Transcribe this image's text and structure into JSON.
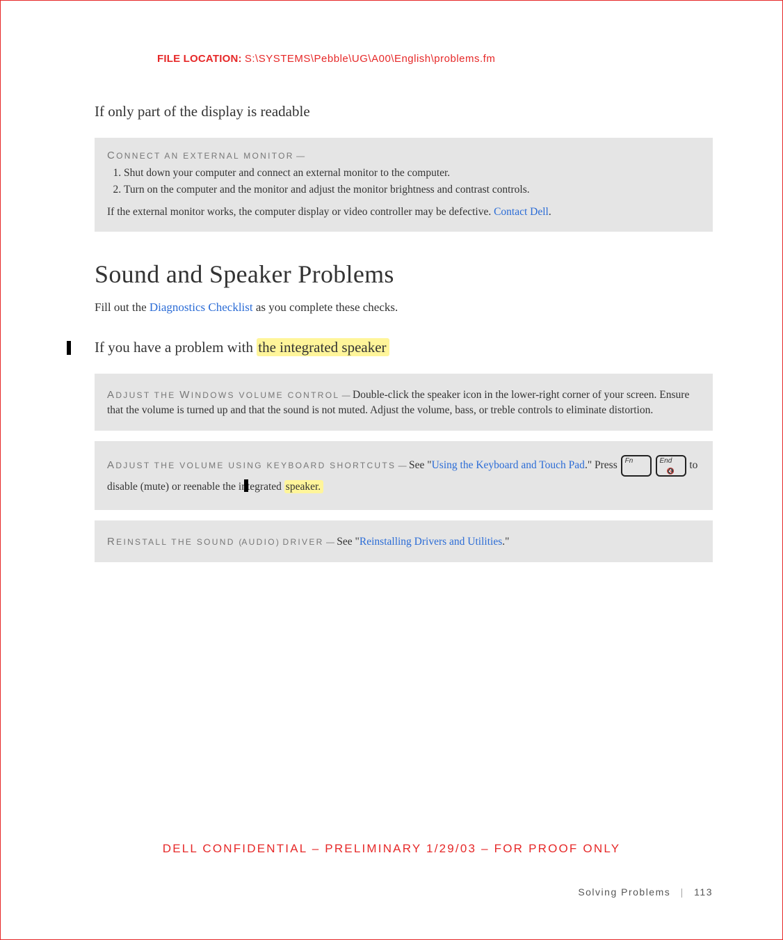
{
  "header": {
    "file_location_label": "FILE LOCATION:",
    "file_location_path": "S:\\SYSTEMS\\Pebble\\UG\\A00\\English\\problems.fm"
  },
  "section1": {
    "heading": "If only part of the display is readable",
    "box": {
      "lead_init": "C",
      "lead_rest": "ONNECT AN EXTERNAL MONITOR",
      "step1": "Shut down your computer and connect an external monitor to the computer.",
      "step2": "Turn on the computer and the monitor and adjust the monitor brightness and contrast controls.",
      "after_text1": "If the external monitor works, the computer display or video controller may be defective. ",
      "after_link": "Contact Dell",
      "after_text2": "."
    }
  },
  "section2": {
    "heading": "Sound and Speaker Problems",
    "intro_pre": "Fill out the ",
    "intro_link": "Diagnostics Checklist",
    "intro_post": " as you complete these checks.",
    "sub_heading_pre": "If you have a problem with ",
    "sub_heading_hl": "the integrated speaker",
    "box1": {
      "lead_init": "A",
      "lead_rest": "DJUST THE ",
      "lead_init2": "W",
      "lead_rest2": "INDOWS VOLUME CONTROL",
      "body": "Double-click the speaker icon in the lower-right corner of your screen. Ensure that the volume is turned up and that the sound is not muted. Adjust the volume, bass, or treble controls to eliminate distortion."
    },
    "box2": {
      "lead_init": "A",
      "lead_rest": "DJUST THE VOLUME USING KEYBOARD SHORTCUTS",
      "see": "See \"",
      "link1": "Using the Keyboard and Touch Pad",
      "mid1": ".\" Press ",
      "key1": "Fn",
      "key2_top": "End",
      "mid2": " to disable (mute) or reenable the integrated ",
      "hl": "speaker."
    },
    "box3": {
      "lead_init": "R",
      "lead_rest": "EINSTALL THE SOUND ",
      "lead_paren1": "(",
      "lead_rest_a": "AUDIO",
      "lead_paren2": ")",
      "lead_rest2": " DRIVER",
      "see": "See \"",
      "link1": "Reinstalling Drivers and Utilities",
      "after": ".\""
    }
  },
  "footer": {
    "confidential": "DELL CONFIDENTIAL – PRELIMINARY 1/29/03 – FOR PROOF ONLY",
    "chapter": "Solving Problems",
    "page": "113"
  }
}
